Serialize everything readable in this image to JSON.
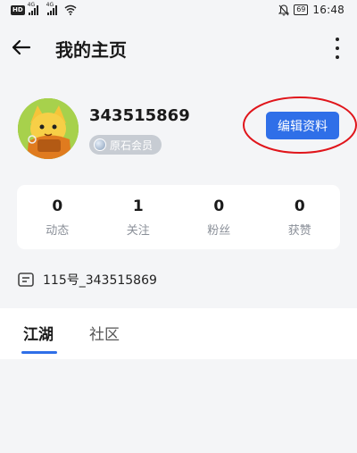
{
  "status_bar": {
    "hd": "HD",
    "network1": "4G",
    "network2": "4G",
    "battery": "69",
    "time": "16:48"
  },
  "header": {
    "back_icon": "arrow-left-icon",
    "title": "我的主页",
    "more_icon": "more-vertical-icon"
  },
  "profile": {
    "username": "343515869",
    "badge": "原石会员",
    "edit_button": "编辑资料"
  },
  "stats": [
    {
      "value": "0",
      "label": "动态"
    },
    {
      "value": "1",
      "label": "关注"
    },
    {
      "value": "0",
      "label": "粉丝"
    },
    {
      "value": "0",
      "label": "获赞"
    }
  ],
  "id_row": {
    "icon": "id-card-icon",
    "text": "115号_343515869"
  },
  "tabs": [
    {
      "label": "江湖",
      "active": true
    },
    {
      "label": "社区",
      "active": false
    }
  ],
  "colors": {
    "accent": "#2f6fe8",
    "annotation": "#e0151b",
    "background": "#f4f5f7"
  }
}
